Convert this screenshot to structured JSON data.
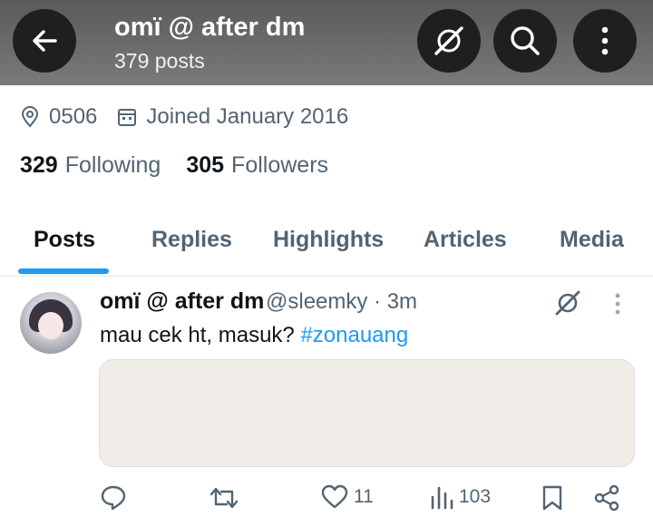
{
  "header": {
    "name": "omï @ after dm",
    "posts_count": "379 posts"
  },
  "profile": {
    "location": "0506",
    "joined": "Joined January 2016",
    "following_count": "329",
    "following_label": "Following",
    "followers_count": "305",
    "followers_label": "Followers"
  },
  "tabs": [
    "Posts",
    "Replies",
    "Highlights",
    "Articles",
    "Media"
  ],
  "active_tab": "Posts",
  "tweet": {
    "author": "omï @ after dm",
    "handle_time": "@sleemky · 3m",
    "text": "mau cek ht, masuk? ",
    "hashtag": "#zonauang",
    "likes": "11",
    "views": "103"
  },
  "colors": {
    "accent": "#1d9bf0",
    "header_bg": "#6a6a6a",
    "button_bg": "#1f1f1f",
    "media_bg": "#f0ede9"
  },
  "icons": [
    "back-arrow-icon",
    "grok-icon",
    "search-icon",
    "more-vertical-icon",
    "location-pin-icon",
    "calendar-icon",
    "reply-icon",
    "retweet-icon",
    "like-icon",
    "views-icon",
    "bookmark-icon",
    "share-icon"
  ]
}
